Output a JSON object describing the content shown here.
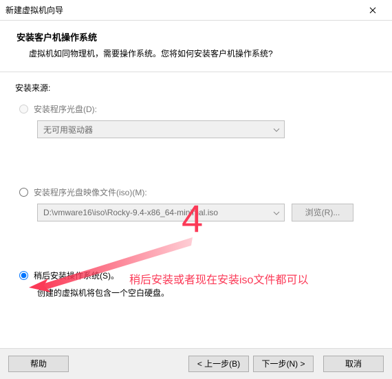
{
  "titlebar": {
    "title": "新建虚拟机向导"
  },
  "header": {
    "title": "安装客户机操作系统",
    "desc": "虚拟机如同物理机，需要操作系统。您将如何安装客户机操作系统?"
  },
  "source": {
    "label": "安装来源:",
    "options": {
      "disc": {
        "label": "安装程序光盘(D):",
        "dropdown_value": "无可用驱动器"
      },
      "iso": {
        "label": "安装程序光盘映像文件(iso)(M):",
        "path_value": "D:\\vmware16\\iso\\Rocky-9.4-x86_64-minimal.iso",
        "browse_label": "浏览(R)..."
      },
      "later": {
        "label": "稍后安装操作系统(S)",
        "subtext": "创建的虚拟机将包含一个空白硬盘。"
      }
    }
  },
  "annotations": {
    "big_number": "4",
    "text": "稍后安装或者现在安装iso文件都可以"
  },
  "footer": {
    "help": "帮助",
    "back": "< 上一步(B)",
    "next": "下一步(N) >",
    "cancel": "取消"
  }
}
